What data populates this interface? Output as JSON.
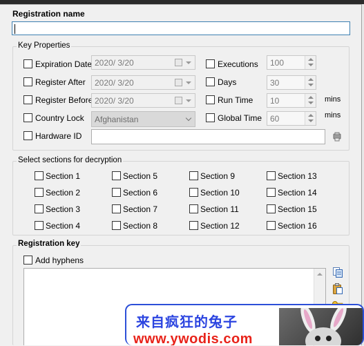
{
  "registration_name": {
    "label": "Registration name",
    "value": ""
  },
  "key_properties": {
    "legend": "Key Properties",
    "expiration_date": {
      "label": "Expiration Date",
      "checked": false,
      "value": "2020/  3/20"
    },
    "register_after": {
      "label": "Register After",
      "checked": false,
      "value": "2020/  3/20"
    },
    "register_before": {
      "label": "Register Before",
      "checked": false,
      "value": "2020/  3/20"
    },
    "country_lock": {
      "label": "Country Lock",
      "checked": false,
      "value": "Afghanistan"
    },
    "hardware_id": {
      "label": "Hardware ID",
      "checked": false,
      "value": ""
    },
    "executions": {
      "label": "Executions",
      "checked": false,
      "value": "100"
    },
    "days": {
      "label": "Days",
      "checked": false,
      "value": "30"
    },
    "run_time": {
      "label": "Run Time",
      "checked": false,
      "value": "10",
      "unit": "mins"
    },
    "global_time": {
      "label": "Global Time",
      "checked": false,
      "value": "60",
      "unit": "mins"
    }
  },
  "sections": {
    "legend": "Select sections for decryption",
    "items": [
      "Section 1",
      "Section 2",
      "Section 3",
      "Section 4",
      "Section 5",
      "Section 6",
      "Section 7",
      "Section 8",
      "Section 9",
      "Section 10",
      "Section 11",
      "Section 12",
      "Section 13",
      "Section 14",
      "Section 15",
      "Section 16"
    ]
  },
  "registration_key": {
    "label": "Registration key",
    "add_hyphens": {
      "label": "Add hyphens",
      "checked": false
    },
    "value": ""
  },
  "icons": {
    "hardware": "hardware-id-icon",
    "copy": "copy-icon",
    "paste": "paste-icon",
    "key": "key-icon"
  },
  "banner": {
    "text": "来自疯狂的兔子",
    "url": "www.ywodis.com"
  },
  "colors": {
    "focus_border": "#3c7fb1",
    "banner_border": "#2c4fd8",
    "banner_text": "#2b44e0",
    "banner_url": "#e8231a"
  }
}
